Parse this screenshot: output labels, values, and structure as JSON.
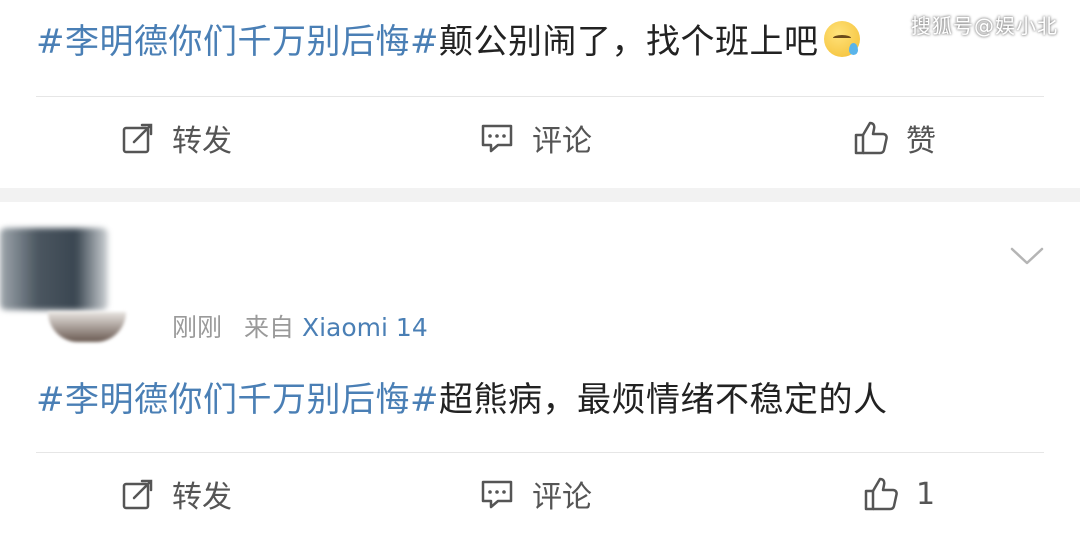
{
  "watermark": "搜狐号@娱小北",
  "post1": {
    "hashtag": "#李明德你们千万别后悔#",
    "text": "颠公别闹了，找个班上吧",
    "emoji": "anxious-sweat-face",
    "actions": {
      "repost": "转发",
      "comment": "评论",
      "like": "赞"
    }
  },
  "post2": {
    "time": "刚刚",
    "source_prefix": "来自",
    "device": "Xiaomi 14",
    "hashtag": "#李明德你们千万别后悔#",
    "text": "超熊病，最烦情绪不稳定的人",
    "actions": {
      "repost": "转发",
      "comment": "评论",
      "like_count": "1"
    }
  },
  "colors": {
    "hashtag": "#4a7fb5",
    "text": "#222222",
    "secondary": "#555555",
    "meta": "#9a9a9a"
  }
}
